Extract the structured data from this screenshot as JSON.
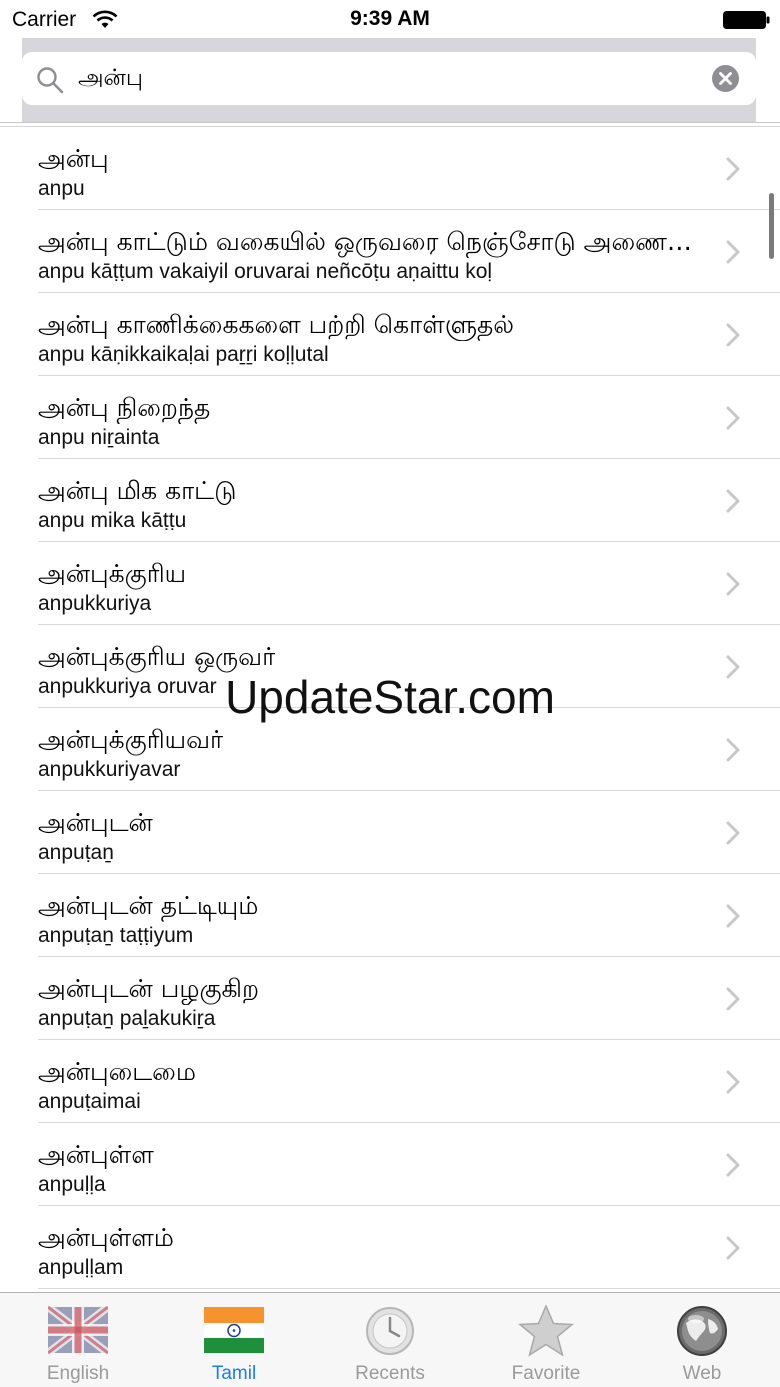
{
  "status_bar": {
    "carrier": "Carrier",
    "time": "9:39 AM"
  },
  "search": {
    "value": "அன்பு",
    "placeholder": ""
  },
  "results": [
    {
      "tamil": "அன்பு",
      "translit": "anpu"
    },
    {
      "tamil": "அன்பு காட்டும் வகையில் ஒருவரை நெஞ்சோடு அணைத்து கொள்",
      "translit": "anpu kāṭṭum vakaiyil oruvarai neñcōṭu aṇaittu koḷ"
    },
    {
      "tamil": "அன்பு காணிக்கைகளை பற்றி கொள்ளுதல்",
      "translit": "anpu kāṇikkaikaḷai paṟṟi koḷḷutal"
    },
    {
      "tamil": "அன்பு நிறைந்த",
      "translit": "anpu niṟainta"
    },
    {
      "tamil": "அன்பு மிக காட்டு",
      "translit": "anpu mika kāṭṭu"
    },
    {
      "tamil": "அன்புக்குரிய",
      "translit": "anpukkuriya"
    },
    {
      "tamil": "அன்புக்குரிய ஒருவர்",
      "translit": "anpukkuriya oruvar"
    },
    {
      "tamil": "அன்புக்குரியவர்",
      "translit": "anpukkuriyavar"
    },
    {
      "tamil": "அன்புடன்",
      "translit": "anpuṭaṉ"
    },
    {
      "tamil": "அன்புடன் தட்டியும்",
      "translit": "anpuṭaṉ taṭṭiyum"
    },
    {
      "tamil": "அன்புடன் பழகுகிற",
      "translit": "anpuṭaṉ paḻakukiṟa"
    },
    {
      "tamil": "அன்புடைமை",
      "translit": "anpuṭaimai"
    },
    {
      "tamil": "அன்புள்ள",
      "translit": "anpuḷḷa"
    },
    {
      "tamil": "அன்புள்ளம்",
      "translit": "anpuḷḷam"
    }
  ],
  "watermark": "UpdateStar.com",
  "tabs": [
    {
      "label": "English",
      "icon": "uk-flag-icon",
      "active": false
    },
    {
      "label": "Tamil",
      "icon": "india-flag-icon",
      "active": true
    },
    {
      "label": "Recents",
      "icon": "clock-icon",
      "active": false
    },
    {
      "label": "Favorite",
      "icon": "star-icon",
      "active": false
    },
    {
      "label": "Web",
      "icon": "globe-icon",
      "active": false
    }
  ],
  "colors": {
    "accent": "#1a7ef5",
    "inactive_tab": "#9a9a9a",
    "search_bar_bg": "#d7d7db"
  }
}
